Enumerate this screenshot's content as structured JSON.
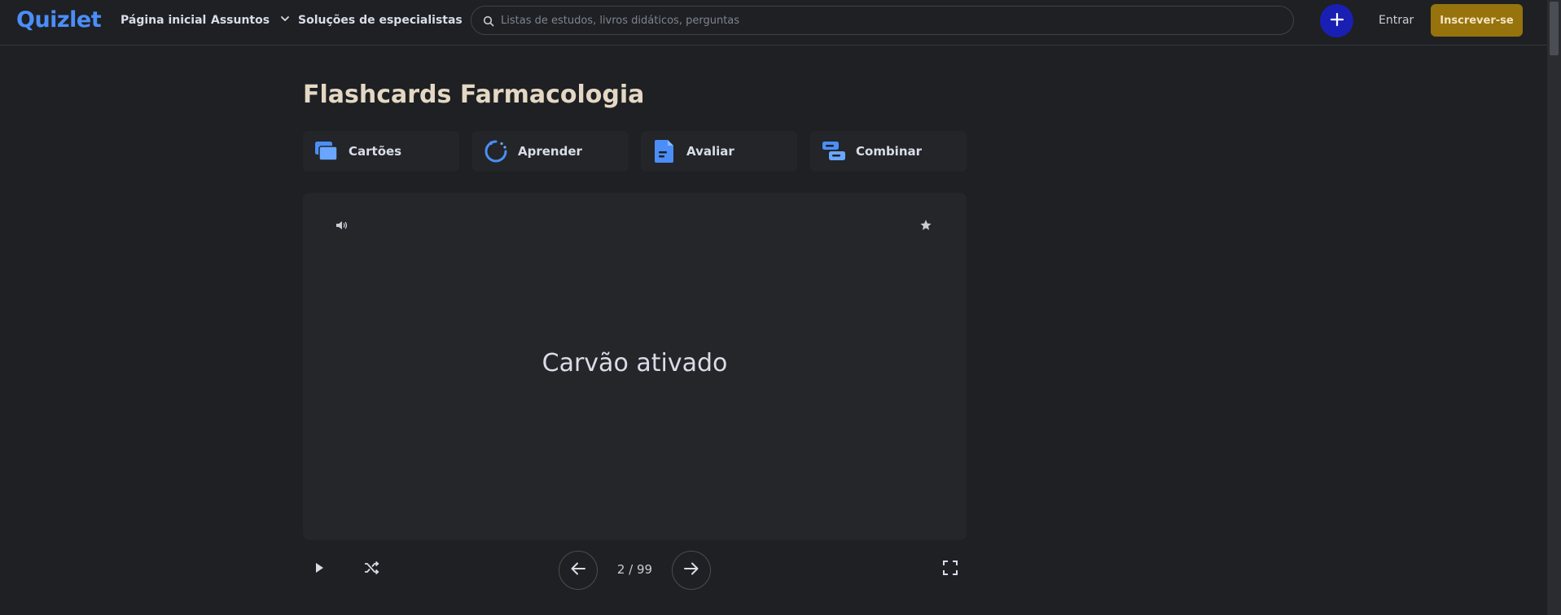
{
  "header": {
    "logo": "Quizlet",
    "nav": {
      "home": "Página inicial",
      "subjects": "Assuntos",
      "experts": "Soluções de especialistas"
    },
    "search_placeholder": "Listas de estudos, livros didáticos, perguntas",
    "login": "Entrar",
    "signup": "Inscrever-se"
  },
  "main": {
    "title": "Flashcards Farmacologia",
    "modes": [
      {
        "label": "Cartões",
        "icon": "cards-icon"
      },
      {
        "label": "Aprender",
        "icon": "learn-icon"
      },
      {
        "label": "Avaliar",
        "icon": "test-icon"
      },
      {
        "label": "Combinar",
        "icon": "match-icon"
      }
    ],
    "card": {
      "term": "Carvão ativado"
    },
    "controls": {
      "counter": "2 / 99",
      "current": 2,
      "total": 99
    }
  },
  "colors": {
    "background": "#1e2023",
    "brand": "#4b8ef8",
    "create_button": "#1a1fb4",
    "signup_button": "#96730d",
    "title": "#e4d8c4"
  }
}
